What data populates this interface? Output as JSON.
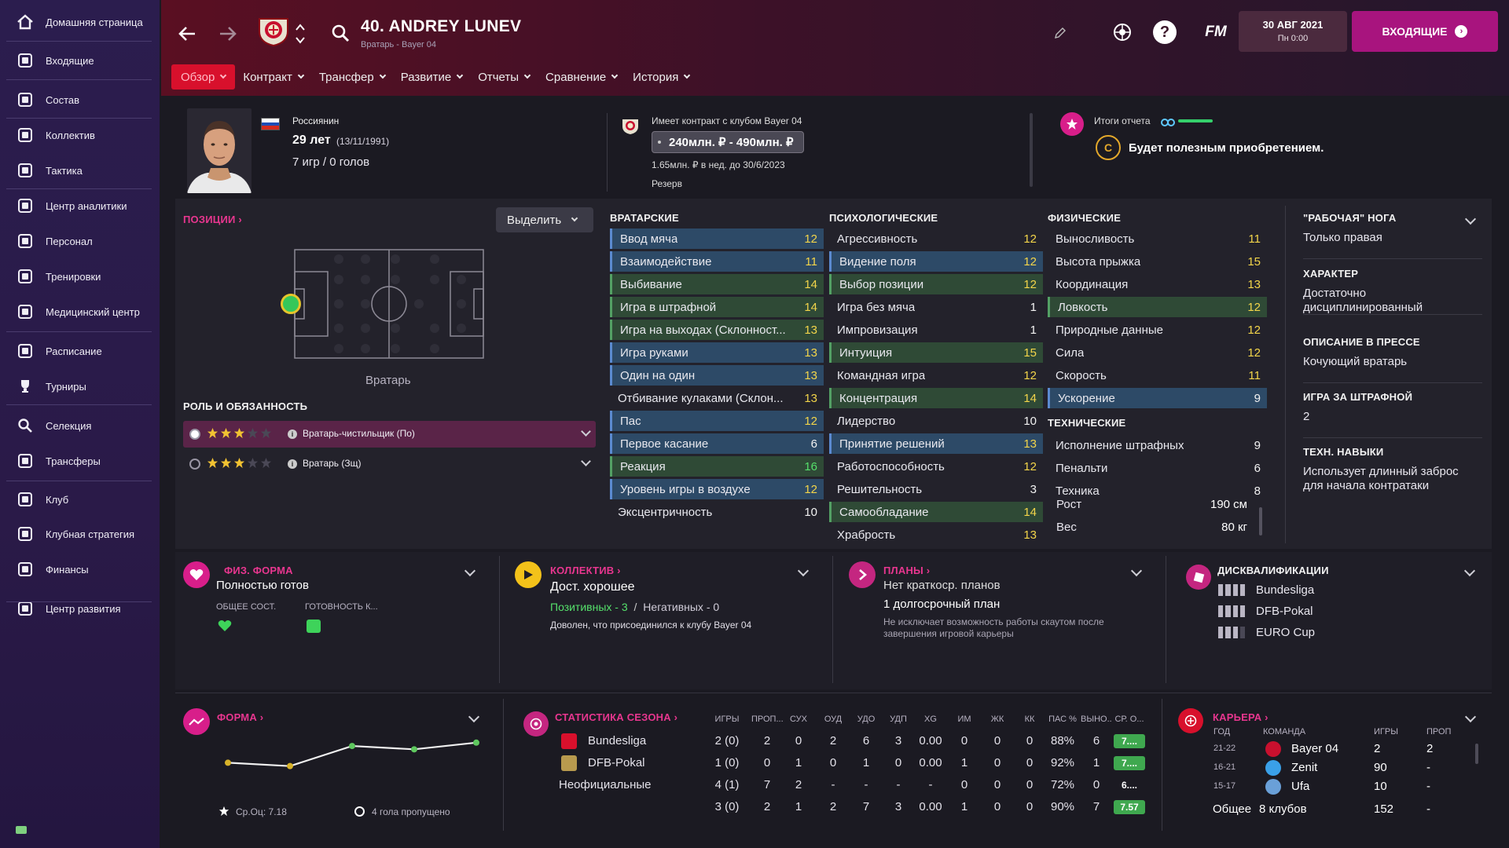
{
  "sidebar": {
    "items": [
      {
        "label": "Домашняя страница",
        "icon": "home-icon"
      },
      {
        "label": "Входящие",
        "icon": "inbox-icon"
      },
      {
        "label": "Состав",
        "icon": "squad-icon"
      },
      {
        "label": "Коллектив",
        "icon": "dynamics-icon"
      },
      {
        "label": "Тактика",
        "icon": "tactics-icon"
      },
      {
        "label": "Центр аналитики",
        "icon": "analytics-icon"
      },
      {
        "label": "Персонал",
        "icon": "staff-icon"
      },
      {
        "label": "Тренировки",
        "icon": "training-icon"
      },
      {
        "label": "Медицинский центр",
        "icon": "medical-icon"
      },
      {
        "label": "Расписание",
        "icon": "calendar-icon"
      },
      {
        "label": "Турниры",
        "icon": "trophy-icon"
      },
      {
        "label": "Селекция",
        "icon": "scouting-icon"
      },
      {
        "label": "Трансферы",
        "icon": "transfers-icon"
      },
      {
        "label": "Клуб",
        "icon": "club-icon"
      },
      {
        "label": "Клубная стратегия",
        "icon": "strategy-icon"
      },
      {
        "label": "Финансы",
        "icon": "finances-icon"
      },
      {
        "label": "Центр развития",
        "icon": "development-icon"
      }
    ]
  },
  "header": {
    "player_title": "40. ANDREY LUNEV",
    "player_subtitle": "Вратарь - Bayer 04",
    "date": "30 АВГ 2021",
    "time": "Пн 0:00",
    "inbox_label": "ВХОДЯЩИЕ",
    "fm_label": "FM"
  },
  "tabs": [
    {
      "label": "Обзор",
      "active": true
    },
    {
      "label": "Контракт"
    },
    {
      "label": "Трансфер"
    },
    {
      "label": "Развитие"
    },
    {
      "label": "Отчеты"
    },
    {
      "label": "Сравнение"
    },
    {
      "label": "История"
    }
  ],
  "profile": {
    "nationality": "Россиянин",
    "age": "29 лет",
    "dob": "(13/11/1991)",
    "caps": "7 игр / 0 голов",
    "contract_text": "Имеет контракт с клубом Bayer 04",
    "value": "240млн. ₽ - 490млн. ₽",
    "wage": "1.65млн. ₽ в нед. до 30/6/2023",
    "status": "Резерв",
    "report_label": "Итоги отчета",
    "report_grade": "C",
    "report_text": "Будет полезным приобретением."
  },
  "positions": {
    "title": "ПОЗИЦИИ",
    "highlight_label": "Выделить",
    "position_name": "Вратарь",
    "roles_title": "РОЛЬ И ОБЯЗАННОСТЬ",
    "roles": [
      {
        "name": "Вратарь-чистильщик (По)",
        "stars": 3
      },
      {
        "name": "Вратарь (Зщ)",
        "stars": 3
      }
    ]
  },
  "attributes": {
    "gk_title": "ВРАТАРСКИЕ",
    "gk": [
      {
        "name": "Ввод мяча",
        "value": "12",
        "hl": "blue",
        "c": "y"
      },
      {
        "name": "Взаимодействие",
        "value": "11",
        "hl": "blue",
        "c": "y"
      },
      {
        "name": "Выбивание",
        "value": "14",
        "hl": "green",
        "c": "y"
      },
      {
        "name": "Игра в штрафной",
        "value": "14",
        "hl": "green",
        "c": "y"
      },
      {
        "name": "Игра на выходах (Склонност...",
        "value": "13",
        "hl": "green",
        "c": "y"
      },
      {
        "name": "Игра руками",
        "value": "13",
        "hl": "blue",
        "c": "y"
      },
      {
        "name": "Один на один",
        "value": "13",
        "hl": "blue",
        "c": "y"
      },
      {
        "name": "Отбивание кулаками (Склон...",
        "value": "13",
        "hl": "",
        "c": "y"
      },
      {
        "name": "Пас",
        "value": "12",
        "hl": "blue",
        "c": "y"
      },
      {
        "name": "Первое касание",
        "value": "6",
        "hl": "blue",
        "c": "w"
      },
      {
        "name": "Реакция",
        "value": "16",
        "hl": "green",
        "c": "g"
      },
      {
        "name": "Уровень игры в воздухе",
        "value": "12",
        "hl": "blue",
        "c": "y"
      },
      {
        "name": "Эксцентричность",
        "value": "10",
        "hl": "",
        "c": "w"
      }
    ],
    "mental_title": "ПСИХОЛОГИЧЕСКИЕ",
    "mental": [
      {
        "name": "Агрессивность",
        "value": "12",
        "hl": "",
        "c": "y"
      },
      {
        "name": "Видение поля",
        "value": "12",
        "hl": "blue",
        "c": "y"
      },
      {
        "name": "Выбор позиции",
        "value": "12",
        "hl": "green",
        "c": "y"
      },
      {
        "name": "Игра без мяча",
        "value": "1",
        "hl": "",
        "c": "w"
      },
      {
        "name": "Импровизация",
        "value": "1",
        "hl": "",
        "c": "w"
      },
      {
        "name": "Интуиция",
        "value": "15",
        "hl": "green",
        "c": "y"
      },
      {
        "name": "Командная игра",
        "value": "12",
        "hl": "",
        "c": "y"
      },
      {
        "name": "Концентрация",
        "value": "14",
        "hl": "green",
        "c": "y"
      },
      {
        "name": "Лидерство",
        "value": "10",
        "hl": "",
        "c": "w"
      },
      {
        "name": "Принятие решений",
        "value": "13",
        "hl": "blue",
        "c": "y"
      },
      {
        "name": "Работоспособность",
        "value": "12",
        "hl": "",
        "c": "y"
      },
      {
        "name": "Решительность",
        "value": "3",
        "hl": "",
        "c": "w"
      },
      {
        "name": "Самообладание",
        "value": "14",
        "hl": "green",
        "c": "y"
      },
      {
        "name": "Храбрость",
        "value": "13",
        "hl": "",
        "c": "y"
      }
    ],
    "physical_title": "ФИЗИЧЕСКИЕ",
    "physical": [
      {
        "name": "Выносливость",
        "value": "11",
        "hl": "",
        "c": "y"
      },
      {
        "name": "Высота прыжка",
        "value": "15",
        "hl": "",
        "c": "y"
      },
      {
        "name": "Координация",
        "value": "13",
        "hl": "",
        "c": "y"
      },
      {
        "name": "Ловкость",
        "value": "12",
        "hl": "green",
        "c": "y"
      },
      {
        "name": "Природные данные",
        "value": "12",
        "hl": "",
        "c": "y"
      },
      {
        "name": "Сила",
        "value": "12",
        "hl": "",
        "c": "y"
      },
      {
        "name": "Скорость",
        "value": "11",
        "hl": "",
        "c": "y"
      },
      {
        "name": "Ускорение",
        "value": "9",
        "hl": "blue",
        "c": "w"
      }
    ],
    "technical_title": "ТЕХНИЧЕСКИЕ",
    "technical": [
      {
        "name": "Исполнение штрафных",
        "value": "9",
        "hl": "",
        "c": "w"
      },
      {
        "name": "Пенальти",
        "value": "6",
        "hl": "",
        "c": "w"
      },
      {
        "name": "Техника",
        "value": "8",
        "hl": "",
        "c": "w"
      }
    ],
    "height_label": "Рост",
    "height": "190 см",
    "weight_label": "Вес",
    "weight": "80 кг"
  },
  "info": {
    "foot_title": "\"РАБОЧАЯ\" НОГА",
    "foot": "Только правая",
    "char_title": "ХАРАКТЕР",
    "char": "Достаточно дисциплинированный",
    "press_title": "ОПИСАНИЕ В ПРЕССЕ",
    "press": "Кочующий вратарь",
    "fk_title": "ИГРА ЗА ШТРАФНОЙ",
    "fk": "2",
    "tech_title": "ТЕХН. НАВЫКИ",
    "tech": "Использует длинный заброс для начала контратаки"
  },
  "fitness": {
    "title": "ФИЗ. ФОРМА",
    "status": "Полностью готов",
    "cond_label": "ОБЩЕЕ СОСТ.",
    "ready_label": "ГОТОВНОСТЬ К..."
  },
  "dynamics": {
    "title": "КОЛЛЕКТИВ",
    "status": "Дост. хорошее",
    "positive": "Позитивных - 3",
    "separator": "/",
    "negative": "Негативных - 0",
    "note": "Доволен, что присоединился к клубу Bayer 04"
  },
  "plans": {
    "title": "ПЛАНЫ",
    "short": "Нет краткоср. планов",
    "long": "1 долгосрочный план",
    "note": "Не исключает возможность работы скаутом после завершения игровой карьеры"
  },
  "bans": {
    "title": "ДИСКВАЛИФИКАЦИИ",
    "items": [
      "Bundesliga",
      "DFB-Pokal",
      "EURO Cup"
    ]
  },
  "form": {
    "title": "ФОРМА",
    "avg": "Ср.Оц: 7.18",
    "conceded": "4 гола пропущено"
  },
  "chart_data": {
    "type": "line",
    "series": [
      {
        "values": [
          6.9,
          6.8,
          7.4,
          7.3,
          7.5
        ]
      }
    ],
    "marker_colors": [
      "#d8b32a",
      "#d8b32a",
      "#5fc85f",
      "#5fc85f",
      "#5fc85f"
    ]
  },
  "season": {
    "title": "СТАТИСТИКА СЕЗОНА",
    "headers": [
      "ИГРЫ",
      "ПРОП...",
      "СУХ",
      "ОУД",
      "УДО",
      "УДП",
      "XG",
      "ИМ",
      "ЖК",
      "КК",
      "ПАС %",
      "ВЫНО...",
      "СР. О..."
    ],
    "rows": [
      {
        "comp": "Bundesliga",
        "cells": [
          "2 (0)",
          "2",
          "0",
          "2",
          "6",
          "3",
          "0.00",
          "0",
          "0",
          "0",
          "88%",
          "6"
        ],
        "rating": "7...."
      },
      {
        "comp": "DFB-Pokal",
        "cells": [
          "1 (0)",
          "0",
          "1",
          "0",
          "1",
          "0",
          "0.00",
          "1",
          "0",
          "0",
          "92%",
          "1"
        ],
        "rating": "7...."
      },
      {
        "comp": "Неофициальные",
        "cells": [
          "4 (1)",
          "7",
          "2",
          "-",
          "-",
          "-",
          "-",
          "0",
          "0",
          "0",
          "72%",
          "0"
        ],
        "rating": "6...."
      },
      {
        "comp": "",
        "cells": [
          "3 (0)",
          "2",
          "1",
          "2",
          "7",
          "3",
          "0.00",
          "1",
          "0",
          "0",
          "90%",
          "7"
        ],
        "rating": "7.57"
      }
    ]
  },
  "career": {
    "title": "КАРЬЕРА",
    "headers": [
      "ГОД",
      "КОМАНДА",
      "ИГРЫ",
      "ПРОП"
    ],
    "rows": [
      {
        "year": "21-22",
        "team": "Bayer 04",
        "games": "2",
        "conc": "2"
      },
      {
        "year": "16-21",
        "team": "Zenit",
        "games": "90",
        "conc": "-"
      },
      {
        "year": "15-17",
        "team": "Ufa",
        "games": "10",
        "conc": "-"
      }
    ],
    "total_label": "Общее",
    "total_clubs": "8 клубов",
    "total_games": "152",
    "total_conc": "-"
  }
}
